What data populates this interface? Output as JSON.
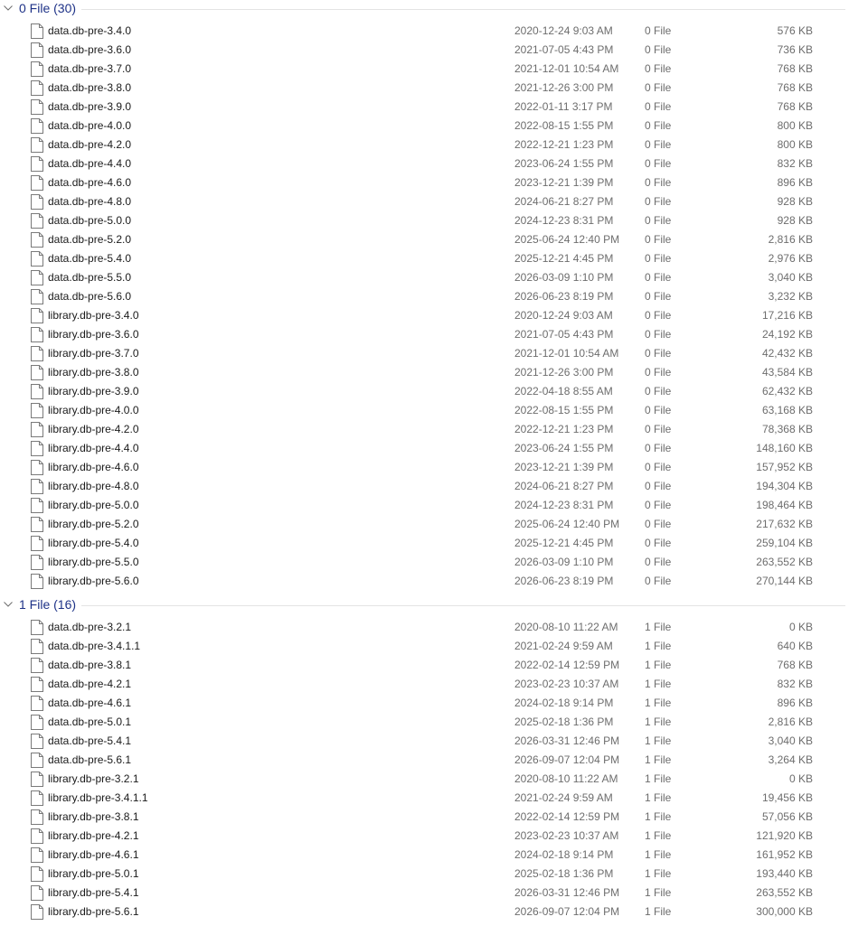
{
  "groups": [
    {
      "title": "0 File (30)",
      "files": [
        {
          "name": "data.db-pre-3.4.0",
          "date": "2020-12-24 9:03 AM",
          "type": "0 File",
          "size": "576 KB"
        },
        {
          "name": "data.db-pre-3.6.0",
          "date": "2021-07-05 4:43 PM",
          "type": "0 File",
          "size": "736 KB"
        },
        {
          "name": "data.db-pre-3.7.0",
          "date": "2021-12-01 10:54 AM",
          "type": "0 File",
          "size": "768 KB"
        },
        {
          "name": "data.db-pre-3.8.0",
          "date": "2021-12-26 3:00 PM",
          "type": "0 File",
          "size": "768 KB"
        },
        {
          "name": "data.db-pre-3.9.0",
          "date": "2022-01-11 3:17 PM",
          "type": "0 File",
          "size": "768 KB"
        },
        {
          "name": "data.db-pre-4.0.0",
          "date": "2022-08-15 1:55 PM",
          "type": "0 File",
          "size": "800 KB"
        },
        {
          "name": "data.db-pre-4.2.0",
          "date": "2022-12-21 1:23 PM",
          "type": "0 File",
          "size": "800 KB"
        },
        {
          "name": "data.db-pre-4.4.0",
          "date": "2023-06-24 1:55 PM",
          "type": "0 File",
          "size": "832 KB"
        },
        {
          "name": "data.db-pre-4.6.0",
          "date": "2023-12-21 1:39 PM",
          "type": "0 File",
          "size": "896 KB"
        },
        {
          "name": "data.db-pre-4.8.0",
          "date": "2024-06-21 8:27 PM",
          "type": "0 File",
          "size": "928 KB"
        },
        {
          "name": "data.db-pre-5.0.0",
          "date": "2024-12-23 8:31 PM",
          "type": "0 File",
          "size": "928 KB"
        },
        {
          "name": "data.db-pre-5.2.0",
          "date": "2025-06-24 12:40 PM",
          "type": "0 File",
          "size": "2,816 KB"
        },
        {
          "name": "data.db-pre-5.4.0",
          "date": "2025-12-21 4:45 PM",
          "type": "0 File",
          "size": "2,976 KB"
        },
        {
          "name": "data.db-pre-5.5.0",
          "date": "2026-03-09 1:10 PM",
          "type": "0 File",
          "size": "3,040 KB"
        },
        {
          "name": "data.db-pre-5.6.0",
          "date": "2026-06-23 8:19 PM",
          "type": "0 File",
          "size": "3,232 KB"
        },
        {
          "name": "library.db-pre-3.4.0",
          "date": "2020-12-24 9:03 AM",
          "type": "0 File",
          "size": "17,216 KB"
        },
        {
          "name": "library.db-pre-3.6.0",
          "date": "2021-07-05 4:43 PM",
          "type": "0 File",
          "size": "24,192 KB"
        },
        {
          "name": "library.db-pre-3.7.0",
          "date": "2021-12-01 10:54 AM",
          "type": "0 File",
          "size": "42,432 KB"
        },
        {
          "name": "library.db-pre-3.8.0",
          "date": "2021-12-26 3:00 PM",
          "type": "0 File",
          "size": "43,584 KB"
        },
        {
          "name": "library.db-pre-3.9.0",
          "date": "2022-04-18 8:55 AM",
          "type": "0 File",
          "size": "62,432 KB"
        },
        {
          "name": "library.db-pre-4.0.0",
          "date": "2022-08-15 1:55 PM",
          "type": "0 File",
          "size": "63,168 KB"
        },
        {
          "name": "library.db-pre-4.2.0",
          "date": "2022-12-21 1:23 PM",
          "type": "0 File",
          "size": "78,368 KB"
        },
        {
          "name": "library.db-pre-4.4.0",
          "date": "2023-06-24 1:55 PM",
          "type": "0 File",
          "size": "148,160 KB"
        },
        {
          "name": "library.db-pre-4.6.0",
          "date": "2023-12-21 1:39 PM",
          "type": "0 File",
          "size": "157,952 KB"
        },
        {
          "name": "library.db-pre-4.8.0",
          "date": "2024-06-21 8:27 PM",
          "type": "0 File",
          "size": "194,304 KB"
        },
        {
          "name": "library.db-pre-5.0.0",
          "date": "2024-12-23 8:31 PM",
          "type": "0 File",
          "size": "198,464 KB"
        },
        {
          "name": "library.db-pre-5.2.0",
          "date": "2025-06-24 12:40 PM",
          "type": "0 File",
          "size": "217,632 KB"
        },
        {
          "name": "library.db-pre-5.4.0",
          "date": "2025-12-21 4:45 PM",
          "type": "0 File",
          "size": "259,104 KB"
        },
        {
          "name": "library.db-pre-5.5.0",
          "date": "2026-03-09 1:10 PM",
          "type": "0 File",
          "size": "263,552 KB"
        },
        {
          "name": "library.db-pre-5.6.0",
          "date": "2026-06-23 8:19 PM",
          "type": "0 File",
          "size": "270,144 KB"
        }
      ]
    },
    {
      "title": "1 File (16)",
      "files": [
        {
          "name": "data.db-pre-3.2.1",
          "date": "2020-08-10 11:22 AM",
          "type": "1 File",
          "size": "0 KB"
        },
        {
          "name": "data.db-pre-3.4.1.1",
          "date": "2021-02-24 9:59 AM",
          "type": "1 File",
          "size": "640 KB"
        },
        {
          "name": "data.db-pre-3.8.1",
          "date": "2022-02-14 12:59 PM",
          "type": "1 File",
          "size": "768 KB"
        },
        {
          "name": "data.db-pre-4.2.1",
          "date": "2023-02-23 10:37 AM",
          "type": "1 File",
          "size": "832 KB"
        },
        {
          "name": "data.db-pre-4.6.1",
          "date": "2024-02-18 9:14 PM",
          "type": "1 File",
          "size": "896 KB"
        },
        {
          "name": "data.db-pre-5.0.1",
          "date": "2025-02-18 1:36 PM",
          "type": "1 File",
          "size": "2,816 KB"
        },
        {
          "name": "data.db-pre-5.4.1",
          "date": "2026-03-31 12:46 PM",
          "type": "1 File",
          "size": "3,040 KB"
        },
        {
          "name": "data.db-pre-5.6.1",
          "date": "2026-09-07 12:04 PM",
          "type": "1 File",
          "size": "3,264 KB"
        },
        {
          "name": "library.db-pre-3.2.1",
          "date": "2020-08-10 11:22 AM",
          "type": "1 File",
          "size": "0 KB"
        },
        {
          "name": "library.db-pre-3.4.1.1",
          "date": "2021-02-24 9:59 AM",
          "type": "1 File",
          "size": "19,456 KB"
        },
        {
          "name": "library.db-pre-3.8.1",
          "date": "2022-02-14 12:59 PM",
          "type": "1 File",
          "size": "57,056 KB"
        },
        {
          "name": "library.db-pre-4.2.1",
          "date": "2023-02-23 10:37 AM",
          "type": "1 File",
          "size": "121,920 KB"
        },
        {
          "name": "library.db-pre-4.6.1",
          "date": "2024-02-18 9:14 PM",
          "type": "1 File",
          "size": "161,952 KB"
        },
        {
          "name": "library.db-pre-5.0.1",
          "date": "2025-02-18 1:36 PM",
          "type": "1 File",
          "size": "193,440 KB"
        },
        {
          "name": "library.db-pre-5.4.1",
          "date": "2026-03-31 12:46 PM",
          "type": "1 File",
          "size": "263,552 KB"
        },
        {
          "name": "library.db-pre-5.6.1",
          "date": "2026-09-07 12:04 PM",
          "type": "1 File",
          "size": "300,000 KB"
        }
      ]
    }
  ],
  "icons": {
    "group_toggle": "chevron-down-icon",
    "file": "file-icon"
  },
  "colors": {
    "group_title": "#1e3287",
    "detail_text": "#6d6d6d",
    "name_text": "#1a1a1a",
    "separator": "#e3e3e3"
  }
}
